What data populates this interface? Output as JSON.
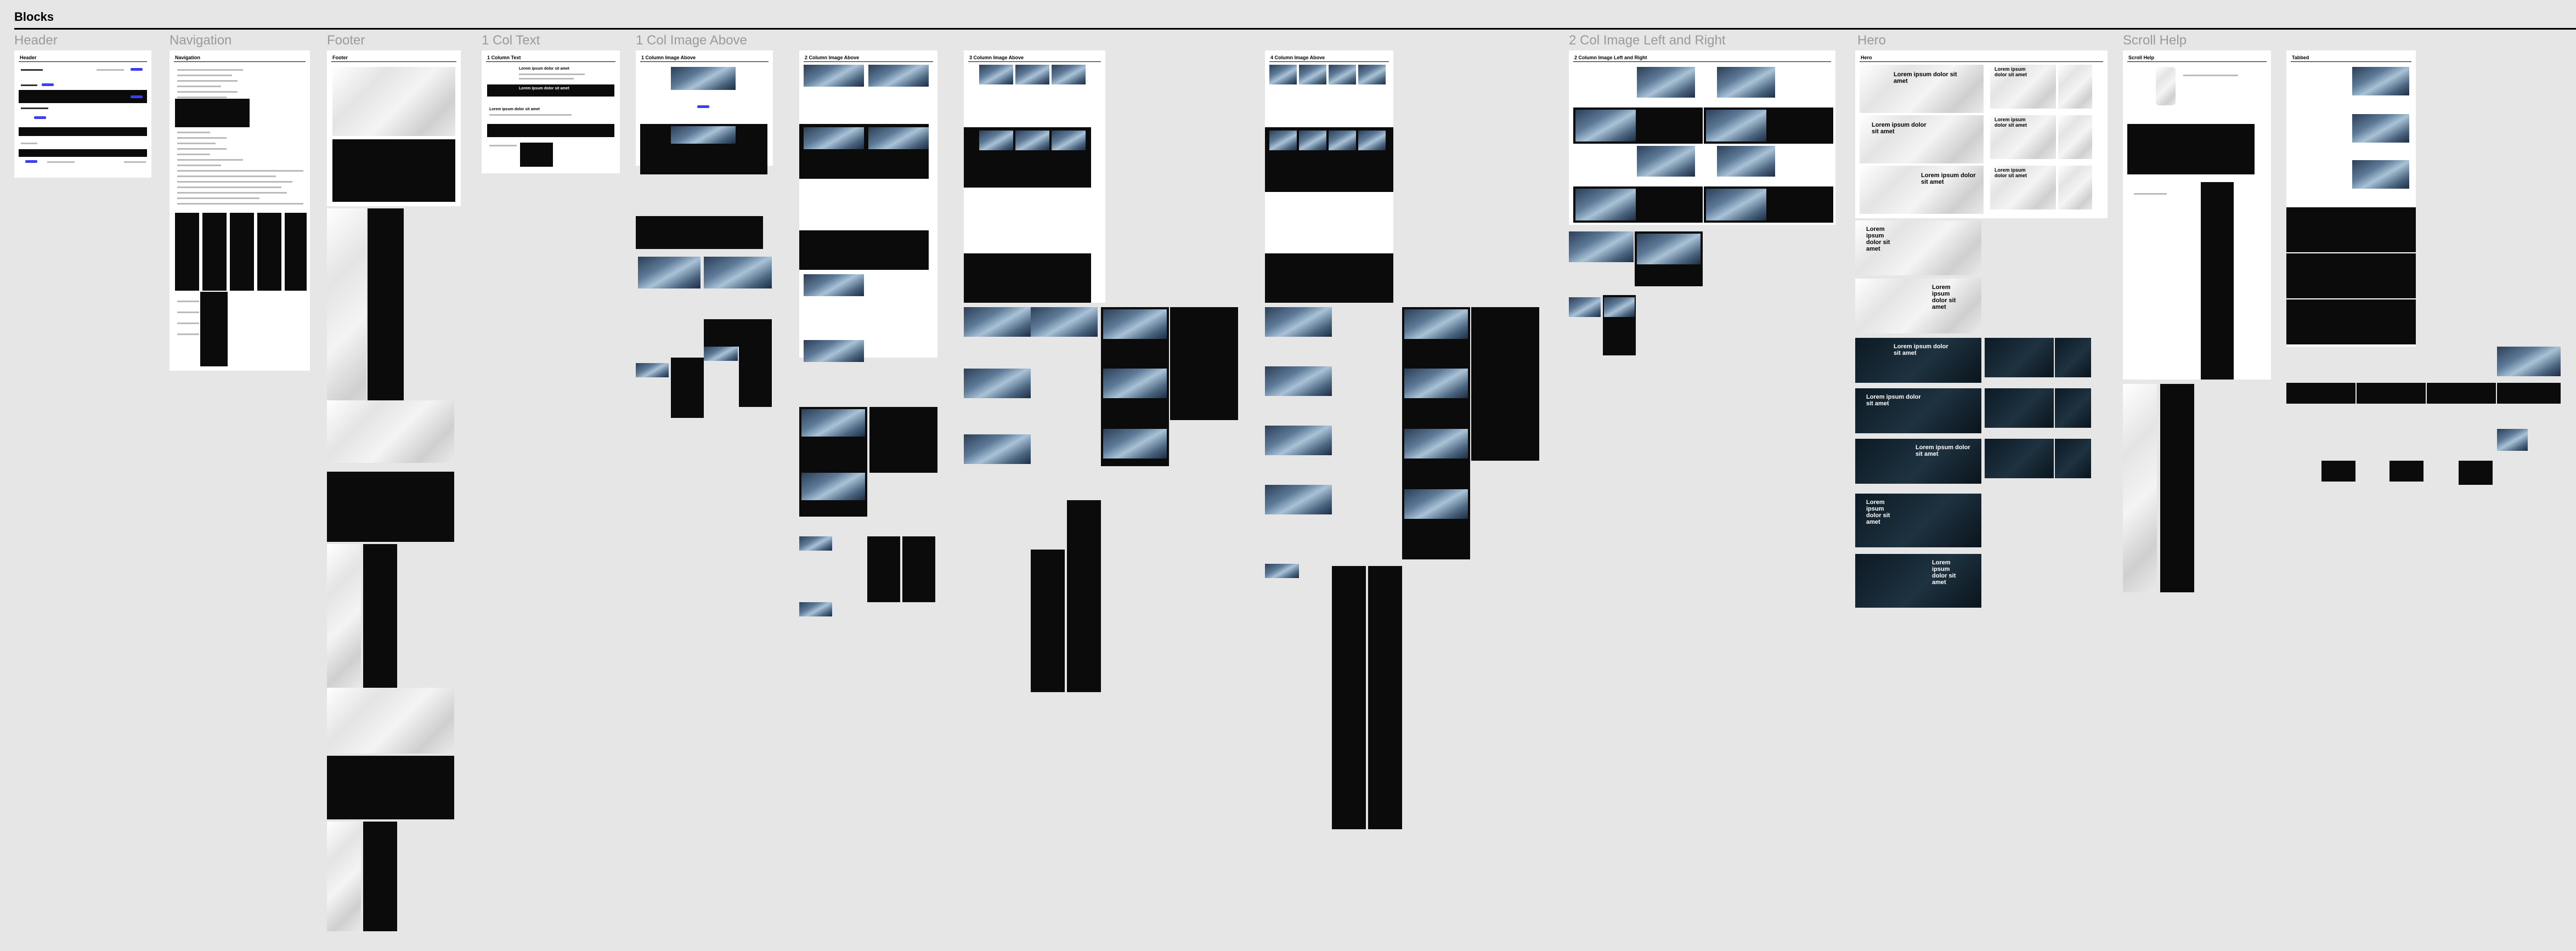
{
  "page": {
    "title": "Blocks"
  },
  "columns": [
    {
      "heading": "Header",
      "frame_label": "Header"
    },
    {
      "heading": "Navigation",
      "frame_label": "Navigation"
    },
    {
      "heading": "Footer",
      "frame_label": "Footer"
    },
    {
      "heading": "1 Col Text",
      "frame_label": "1 Column Text"
    },
    {
      "heading": "1 Col Image Above",
      "frame_label": "1 Column Image Above"
    },
    {
      "heading": "",
      "frame_label": "2 Column Image Above"
    },
    {
      "heading": "",
      "frame_label": "3 Column Image Above"
    },
    {
      "heading": "",
      "frame_label": "4 Column Image Above"
    },
    {
      "heading": "2 Col Image Left and Right",
      "frame_label": "2 Column Image Left and Right"
    },
    {
      "heading": "Hero",
      "frame_label": "Hero"
    },
    {
      "heading": "Scroll Help",
      "frame_label": "Scroll Help"
    },
    {
      "heading": "",
      "frame_label": "Tabbed"
    }
  ],
  "sample_text": {
    "heading": "Lorem ipsum dolor sit amet"
  },
  "colors": {
    "background": "#e6e6e6",
    "accent": "#3b3ff0",
    "dark": "#0b0b0b"
  }
}
